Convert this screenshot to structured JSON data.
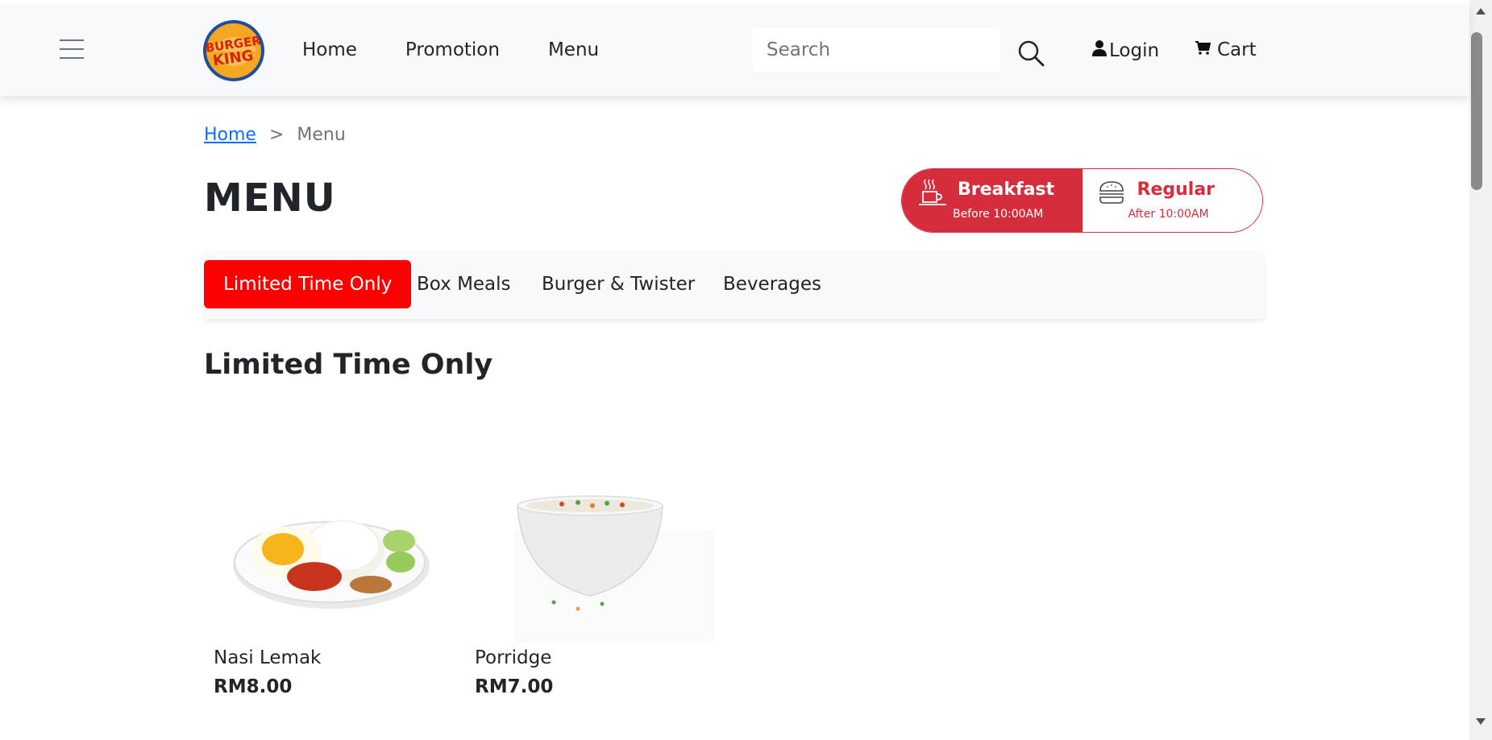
{
  "header": {
    "logo_text": "BURGER KING",
    "nav": [
      {
        "label": "Home"
      },
      {
        "label": "Promotion"
      },
      {
        "label": "Menu"
      }
    ],
    "search": {
      "placeholder": "Search",
      "value": ""
    },
    "login_label": "Login",
    "cart_label": "Cart"
  },
  "breadcrumb": {
    "home": "Home",
    "separator": ">",
    "current": "Menu"
  },
  "page_title": "MENU",
  "time_toggle": {
    "breakfast": {
      "label": "Breakfast",
      "sub": "Before 10:00AM",
      "active": true
    },
    "regular": {
      "label": "Regular",
      "sub": "After 10:00AM",
      "active": false
    }
  },
  "tabs": [
    {
      "label": "Limited Time Only",
      "active": true
    },
    {
      "label": "Box Meals",
      "active": false
    },
    {
      "label": "Burger & Twister",
      "active": false
    },
    {
      "label": "Beverages",
      "active": false
    }
  ],
  "section_title": "Limited Time Only",
  "products": [
    {
      "name": "Nasi Lemak",
      "price": "RM8.00"
    },
    {
      "name": "Porridge",
      "price": "RM7.00"
    }
  ],
  "colors": {
    "brand_red": "#d62d3c",
    "active_tab": "#ff0000",
    "link": "#0d6efd",
    "header_bg": "#f8f9fa"
  }
}
